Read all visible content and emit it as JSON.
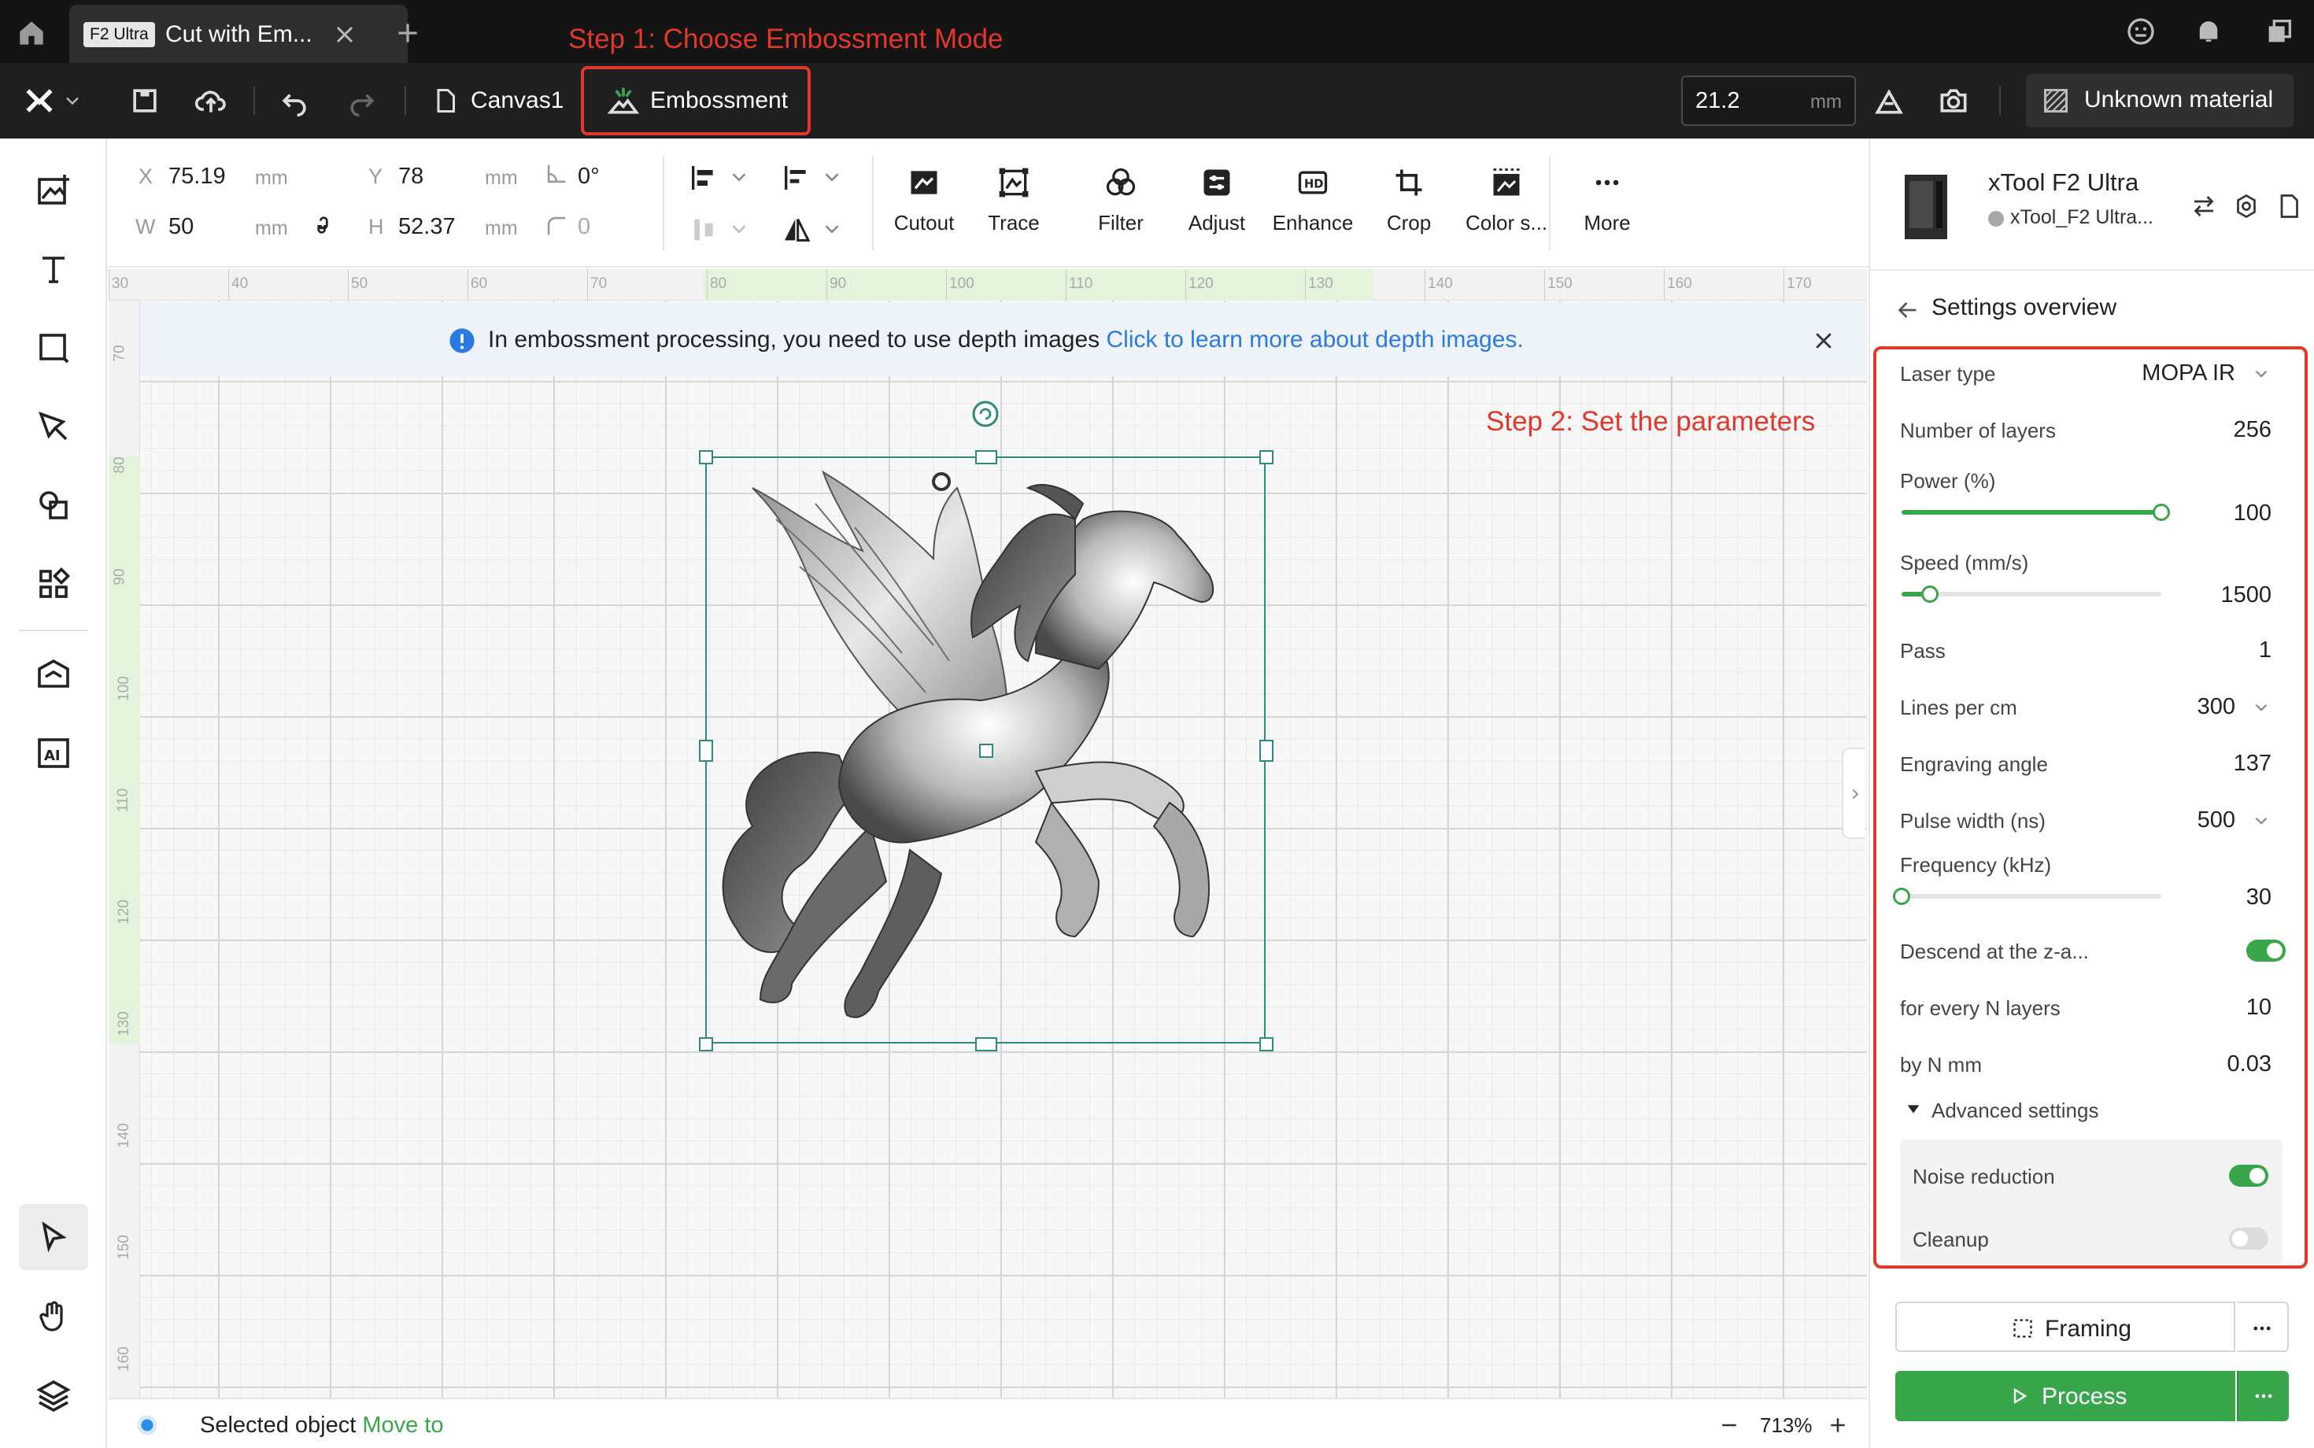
{
  "annotations": {
    "step1": "Step 1: Choose Embossment Mode",
    "step2": "Step 2: Set the parameters"
  },
  "titlebar": {
    "tab_badge": "F2 Ultra",
    "tab_title": "Cut with Em..."
  },
  "toolbar": {
    "canvas_label": "Canvas1",
    "mode_label": "Embossment",
    "thickness_value": "21.2",
    "thickness_unit": "mm",
    "material_label": "Unknown material"
  },
  "properties": {
    "x_label": "X",
    "x_value": "75.19",
    "x_unit": "mm",
    "y_label": "Y",
    "y_value": "78",
    "y_unit": "mm",
    "w_label": "W",
    "w_value": "50",
    "w_unit": "mm",
    "h_label": "H",
    "h_value": "52.37",
    "h_unit": "mm",
    "rotation": "0°",
    "corner": "0",
    "tools": [
      {
        "label": "Cutout",
        "icon": "cutout-icon"
      },
      {
        "label": "Trace",
        "icon": "trace-icon"
      },
      {
        "label": "Filter",
        "icon": "filter-icon"
      },
      {
        "label": "Adjust",
        "icon": "adjust-icon"
      },
      {
        "label": "Enhance",
        "icon": "hd-icon"
      },
      {
        "label": "Crop",
        "icon": "crop-icon"
      },
      {
        "label": "Color s...",
        "icon": "color-separation-icon"
      },
      {
        "label": "More",
        "icon": "more-icon"
      }
    ]
  },
  "ruler": {
    "h_ticks": [
      "30",
      "40",
      "50",
      "60",
      "70",
      "80",
      "90",
      "100",
      "110",
      "120",
      "130",
      "140",
      "150",
      "160",
      "170"
    ],
    "v_ticks": [
      "70",
      "80",
      "90",
      "100",
      "110",
      "120",
      "130",
      "140",
      "150",
      "160"
    ]
  },
  "banner": {
    "text": "In embossment processing, you need to use depth images",
    "link": "Click to learn more about depth images."
  },
  "statusbar": {
    "text": "Selected object",
    "link": "Move to",
    "zoom": "713%"
  },
  "device": {
    "name": "xTool F2 Ultra",
    "subname": "xTool_F2 Ultra..."
  },
  "settings": {
    "title": "Settings overview",
    "laser_type_label": "Laser type",
    "laser_type_value": "MOPA IR",
    "layers_label": "Number of layers",
    "layers_value": "256",
    "power_label": "Power (%)",
    "power_value": "100",
    "power_fraction": 1.0,
    "speed_label": "Speed (mm/s)",
    "speed_value": "1500",
    "speed_fraction": 0.11,
    "pass_label": "Pass",
    "pass_value": "1",
    "lines_label": "Lines per cm",
    "lines_value": "300",
    "angle_label": "Engraving angle",
    "angle_value": "137",
    "pulse_label": "Pulse width (ns)",
    "pulse_value": "500",
    "freq_label": "Frequency (kHz)",
    "freq_value": "30",
    "freq_fraction": 0.0,
    "descend_label": "Descend at the z-a...",
    "descend_on": true,
    "every_label": "for every N layers",
    "every_value": "10",
    "byn_label": "by N mm",
    "byn_value": "0.03",
    "advanced_label": "Advanced settings",
    "noise_label": "Noise reduction",
    "noise_on": true,
    "cleanup_label": "Cleanup",
    "cleanup_on": false
  },
  "actions": {
    "framing_label": "Framing",
    "process_label": "Process"
  },
  "colors": {
    "accent_green": "#3aa64b",
    "annotation_red": "#e2372b",
    "link_blue": "#2a7ae2",
    "selection_teal": "#2f8a7e"
  }
}
